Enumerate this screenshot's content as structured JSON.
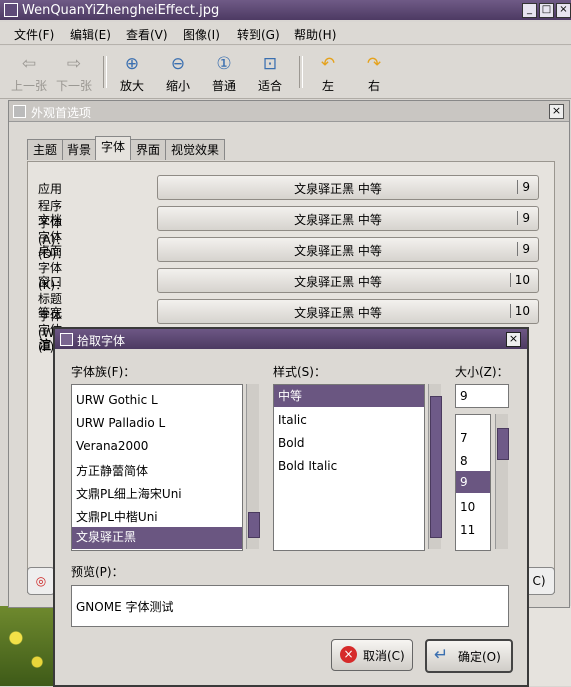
{
  "main_window": {
    "title": "WenQuanYiZhengheiEffect.jpg",
    "menu": [
      "文件(F)",
      "编辑(E)",
      "查看(V)",
      "图像(I)",
      "转到(G)",
      "帮助(H)"
    ],
    "toolbar": [
      {
        "label": "上一张",
        "icon": "arrow-left-icon",
        "enabled": false
      },
      {
        "label": "下一张",
        "icon": "arrow-right-icon",
        "enabled": false
      },
      {
        "label": "放大",
        "icon": "zoom-in-icon",
        "enabled": true
      },
      {
        "label": "缩小",
        "icon": "zoom-out-icon",
        "enabled": true
      },
      {
        "label": "普通",
        "icon": "zoom-normal-icon",
        "enabled": true
      },
      {
        "label": "适合",
        "icon": "zoom-fit-icon",
        "enabled": true
      },
      {
        "label": "左",
        "icon": "rotate-left-icon",
        "enabled": true
      },
      {
        "label": "右",
        "icon": "rotate-right-icon",
        "enabled": true
      }
    ]
  },
  "appearance_window": {
    "title": "外观首选项",
    "tabs": [
      "主题",
      "背景",
      "字体",
      "界面",
      "视觉效果"
    ],
    "active_tab": "字体",
    "font_rows": [
      {
        "label": "应用程序字体(A)：",
        "font": "文泉驿正黑 中等",
        "size": "9"
      },
      {
        "label": "文档字体(D)：",
        "font": "文泉驿正黑 中等",
        "size": "9"
      },
      {
        "label": "桌面字体(K)：",
        "font": "文泉驿正黑 中等",
        "size": "9"
      },
      {
        "label": "窗口标题字体(W)：",
        "font": "文泉驿正黑 中等",
        "size": "10"
      },
      {
        "label": "等宽字体(F)：",
        "font": "文泉驿正黑 中等",
        "size": "10"
      }
    ],
    "section_heading_partial": "渲"
  },
  "font_dialog": {
    "title": "拾取字体",
    "family_label": "字体族(F)：",
    "style_label": "样式(S)：",
    "size_label": "大小(Z)：",
    "families": [
      "URW Gothic L",
      "URW Palladio L",
      "Verana2000",
      "方正静蕾简体",
      "文鼎PL细上海宋Uni",
      "文鼎PL中楷Uni",
      "文泉驿正黑"
    ],
    "selected_family": "文泉驿正黑",
    "styles": [
      "中等",
      "Italic",
      "Bold",
      "Bold Italic"
    ],
    "selected_style": "中等",
    "size_value": "9",
    "sizes": [
      "7",
      "8",
      "9",
      "10",
      "11"
    ],
    "selected_size": "9",
    "preview_label": "预览(P)：",
    "preview_text": "GNOME 字体测试",
    "cancel_label": "取消(C)",
    "ok_label": "确定(O)"
  },
  "colors": {
    "accent": "#6a5681",
    "titlebar": "#5a4772",
    "window_bg": "#dcd9d4"
  }
}
